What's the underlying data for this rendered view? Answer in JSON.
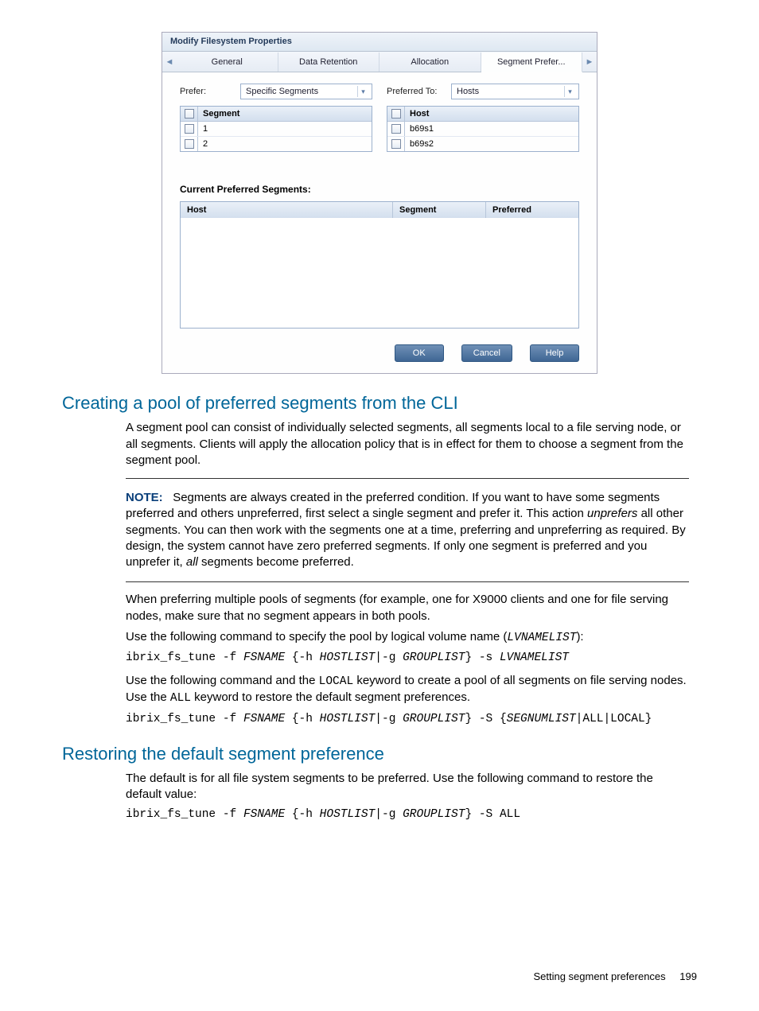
{
  "dialog": {
    "title": "Modify Filesystem Properties",
    "tabs": [
      "General",
      "Data Retention",
      "Allocation",
      "Segment Prefer..."
    ],
    "active_tab_index": 3,
    "prefer_label": "Prefer:",
    "prefer_value": "Specific Segments",
    "preferred_to_label": "Preferred To:",
    "preferred_to_value": "Hosts",
    "segment_table": {
      "header": "Segment",
      "rows": [
        "1",
        "2"
      ]
    },
    "host_table": {
      "header": "Host",
      "rows": [
        "b69s1",
        "b69s2"
      ]
    },
    "section_heading": "Current Preferred Segments:",
    "pref_table_headers": [
      "Host",
      "Segment",
      "Preferred"
    ],
    "buttons": {
      "ok": "OK",
      "cancel": "Cancel",
      "help": "Help"
    }
  },
  "sec1": {
    "heading": "Creating a pool of preferred segments from the CLI",
    "p1": "A segment pool can consist of individually selected segments, all segments local to a file serving node, or all segments. Clients will apply the allocation policy that is in effect for them to choose a segment from the segment pool.",
    "note_label": "NOTE:",
    "note_body_1": "Segments are always created in the preferred condition. If you want to have some segments preferred and others unpreferred, first select a single segment and prefer it. This action ",
    "note_unprefers": "unprefers",
    "note_body_2": " all other segments. You can then work with the segments one at a time, preferring and unpreferring as required. By design, the system cannot have zero preferred segments. If only one segment is preferred and you unprefer it, ",
    "note_all": "all",
    "note_body_3": " segments become preferred.",
    "p2": "When preferring multiple pools of segments (for example, one for X9000 clients and one for file serving nodes, make sure that no segment appears in both pools.",
    "p3_a": "Use the following command to specify the pool by logical volume name (",
    "p3_code": "LVNAMELIST",
    "p3_b": "):",
    "cmd1_pre": "ibrix_fs_tune -f ",
    "cmd1_fs": "FSNAME",
    "cmd1_mid1": " {-h ",
    "cmd1_hl": "HOSTLIST",
    "cmd1_mid2": "|-g ",
    "cmd1_gl": "GROUPLIST",
    "cmd1_mid3": "} -s ",
    "cmd1_lv": "LVNAMELIST",
    "p4_a": "Use the following command and the ",
    "p4_local": "LOCAL",
    "p4_b": " keyword to create a pool of all segments on file serving nodes. Use the ",
    "p4_all": "ALL",
    "p4_c": " keyword to restore the default segment preferences.",
    "cmd2_pre": "ibrix_fs_tune -f ",
    "cmd2_fs": "FSNAME",
    "cmd2_mid1": " {-h ",
    "cmd2_hl": "HOSTLIST",
    "cmd2_mid2": "|-g ",
    "cmd2_gl": "GROUPLIST",
    "cmd2_mid3": "} -S {",
    "cmd2_seg": "SEGNUMLIST",
    "cmd2_mid4": "|ALL|LOCAL}"
  },
  "sec2": {
    "heading": "Restoring the default segment preference",
    "p1": "The default is for all file system segments to be preferred. Use the following command to restore the default value:",
    "cmd_pre": "ibrix_fs_tune -f ",
    "cmd_fs": "FSNAME",
    "cmd_mid1": " {-h ",
    "cmd_hl": "HOSTLIST",
    "cmd_mid2": "|-g ",
    "cmd_gl": "GROUPLIST",
    "cmd_mid3": "} -S ALL"
  },
  "footer": {
    "text": "Setting segment preferences",
    "page": "199"
  }
}
